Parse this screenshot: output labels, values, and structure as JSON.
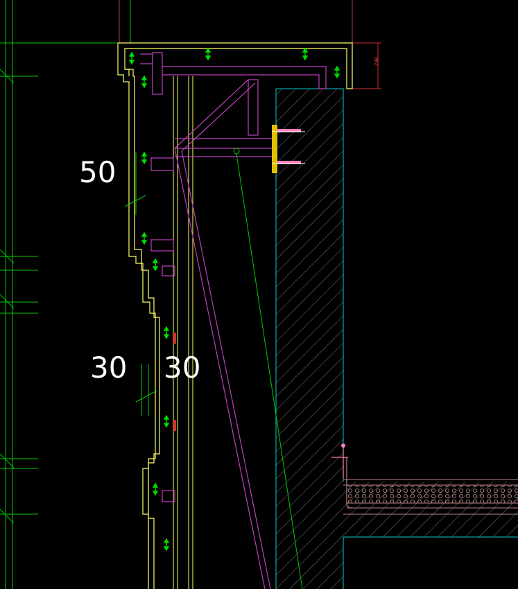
{
  "drawing": {
    "dimensions": {
      "label_top": "50",
      "label_left": "30",
      "label_right": "30",
      "top_height": "200"
    },
    "colors": {
      "background": "#000000",
      "outline_yellow": "#ffff66",
      "grid_green": "#00dd00",
      "frame_magenta": "#c040c0",
      "concrete_cyan": "#00cccc",
      "hatch_gray": "#8a8a8a",
      "dimension_red": "#d03030",
      "anchor_yellow": "#e0c000",
      "anchor_pink": "#ff80c0",
      "text_white": "#ffffff"
    }
  }
}
